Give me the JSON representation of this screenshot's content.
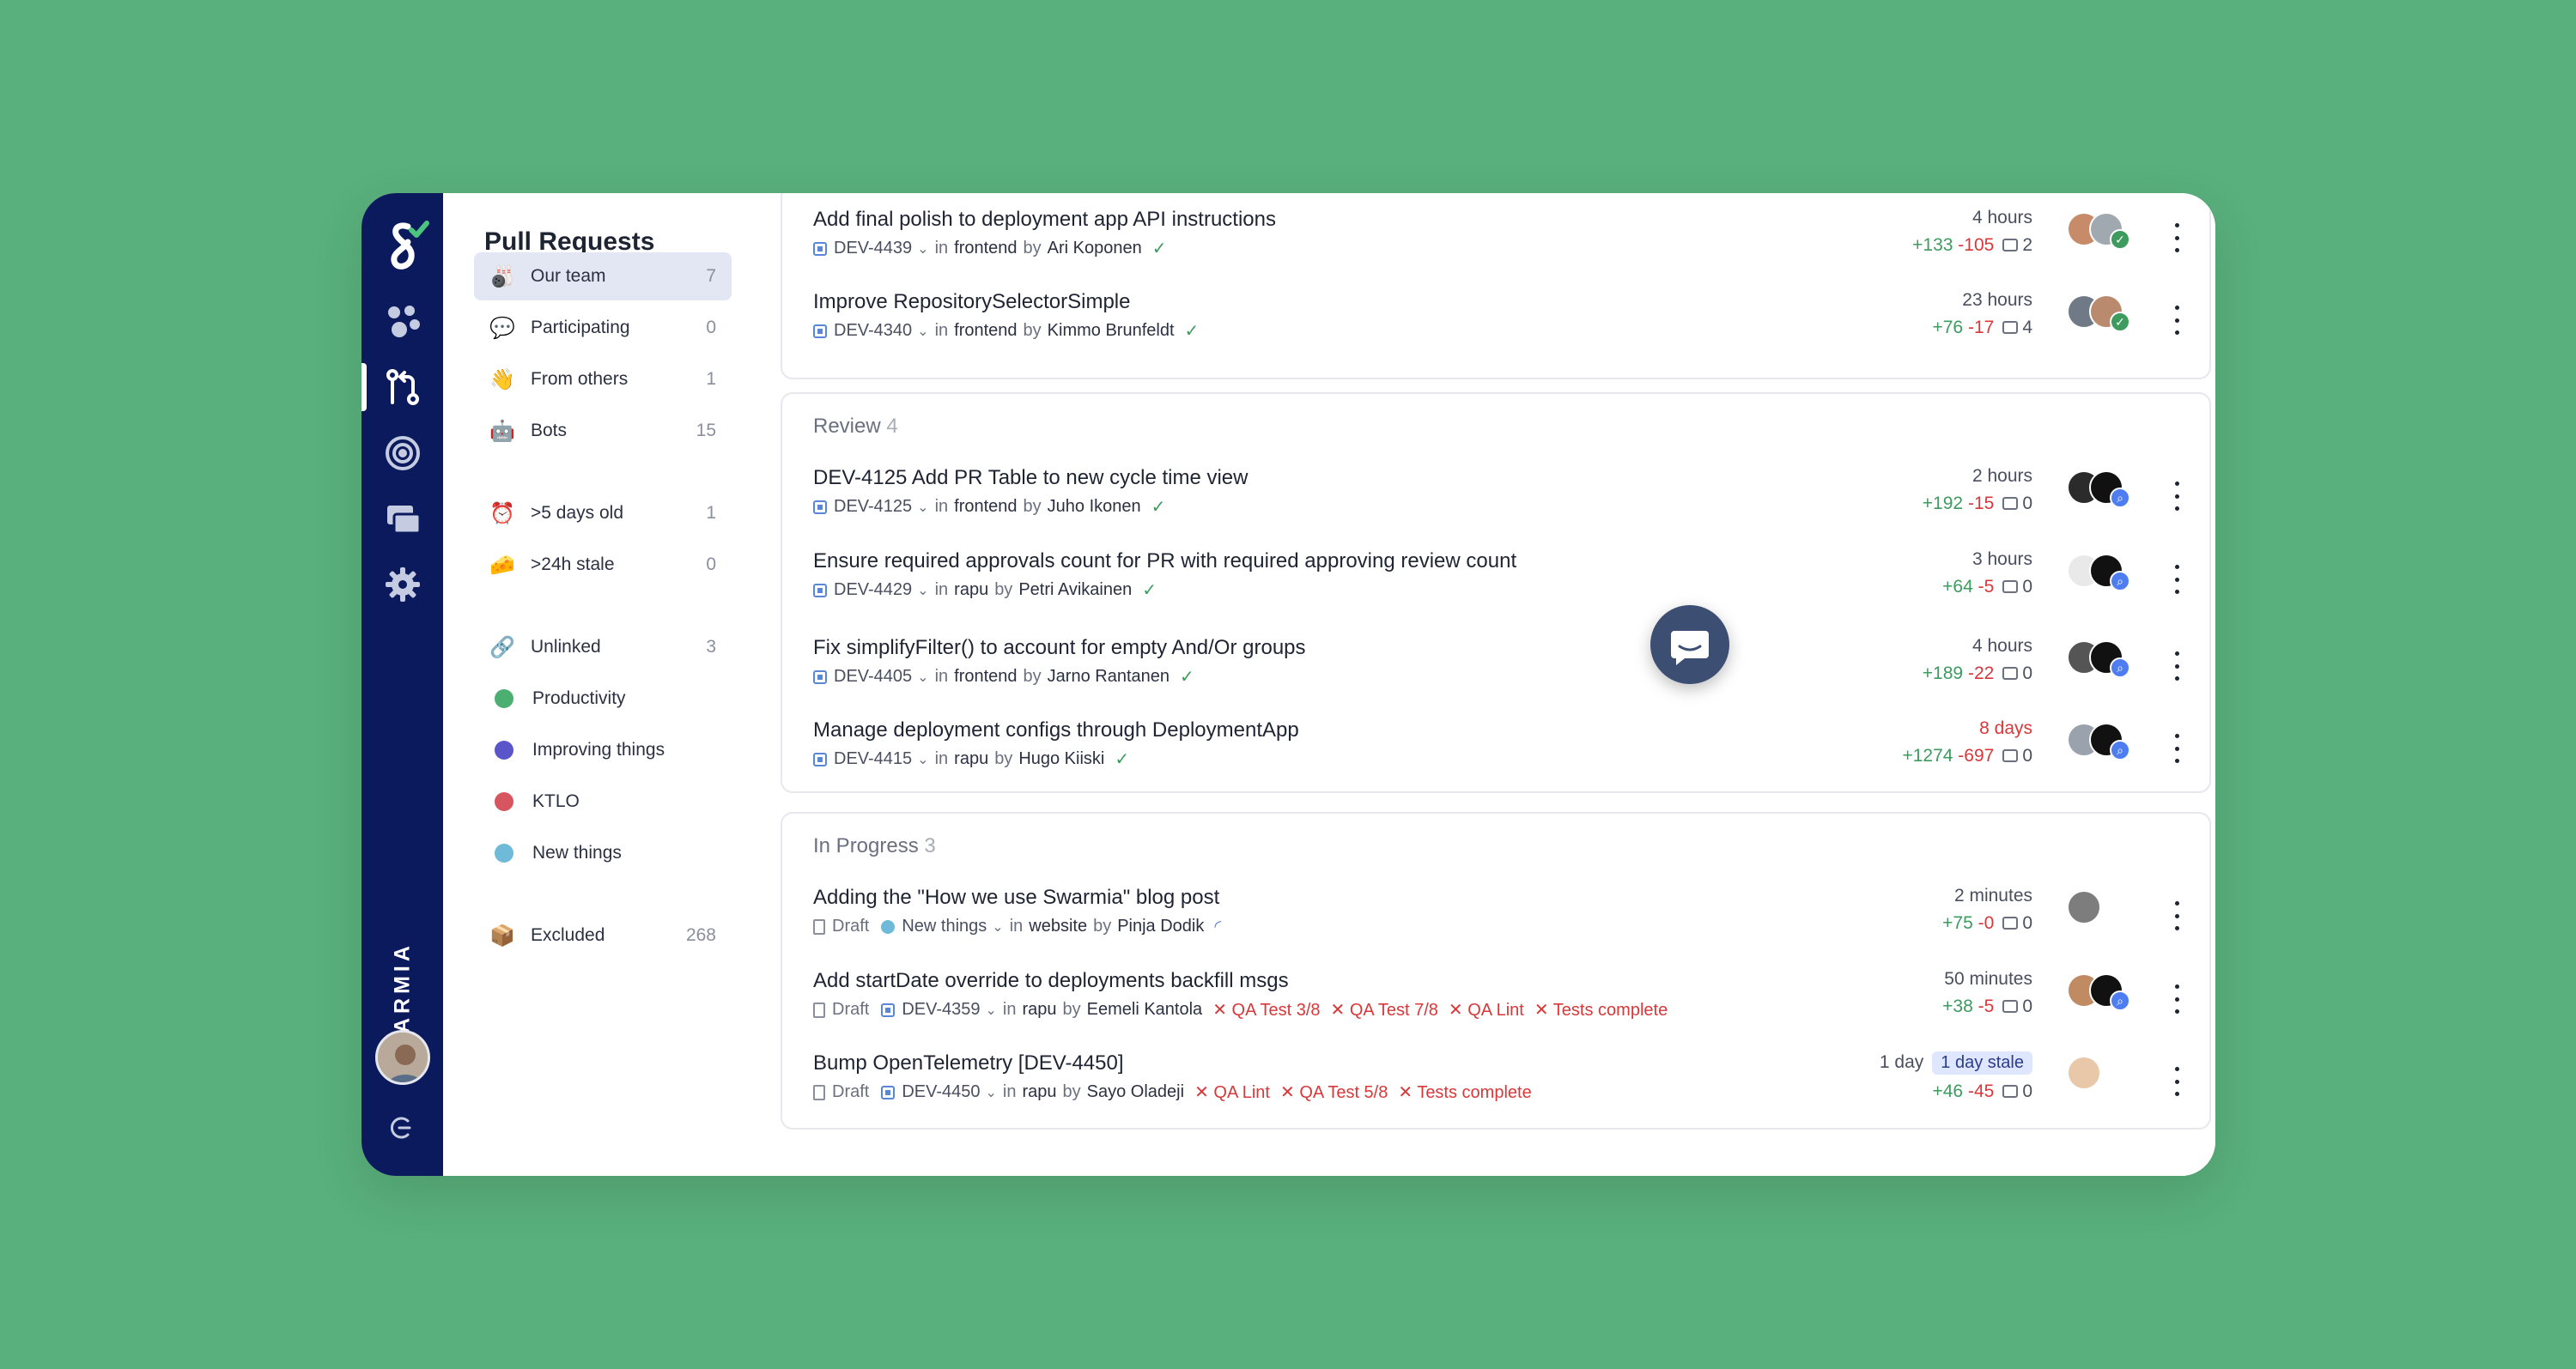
{
  "brand": "SWARMIA",
  "sidebar": {
    "title": "Pull Requests",
    "items": [
      {
        "emoji": "🎳",
        "label": "Our team",
        "count": "7"
      },
      {
        "emoji": "💬",
        "label": "Participating",
        "count": "0"
      },
      {
        "emoji": "👋",
        "label": "From others",
        "count": "1"
      },
      {
        "emoji": "🤖",
        "label": "Bots",
        "count": "15"
      },
      {
        "emoji": "⏰",
        "label": ">5 days old",
        "count": "1"
      },
      {
        "emoji": "🧀",
        "label": ">24h stale",
        "count": "0"
      },
      {
        "emoji": "🔗",
        "label": "Unlinked",
        "count": "3"
      },
      {
        "color": "#4caf72",
        "label": "Productivity",
        "count": ""
      },
      {
        "color": "#5a55c9",
        "label": "Improving things",
        "count": ""
      },
      {
        "color": "#d6555e",
        "label": "KTLO",
        "count": ""
      },
      {
        "color": "#6fbad9",
        "label": "New things",
        "count": ""
      },
      {
        "emoji": "📦",
        "label": "Excluded",
        "count": "268"
      }
    ]
  },
  "colors": {
    "accent": "#0b1a5c",
    "add": "#3d9b5e",
    "del": "#d8383a",
    "bg": "#59b07c"
  },
  "top_prs": [
    {
      "title": "Add final polish to deployment app API instructions",
      "key": "DEV-4439",
      "repo": "frontend",
      "author": "Ari Koponen",
      "time": "4 hours",
      "add": "+133",
      "del": "-105",
      "comments": "2"
    },
    {
      "title": "Improve RepositorySelectorSimple",
      "key": "DEV-4340",
      "repo": "frontend",
      "author": "Kimmo Brunfeldt",
      "time": "23 hours",
      "add": "+76",
      "del": "-17",
      "comments": "4"
    }
  ],
  "review": {
    "title": "Review",
    "count": "4",
    "prs": [
      {
        "title": "DEV-4125 Add PR Table to new cycle time view",
        "key": "DEV-4125",
        "repo": "frontend",
        "author": "Juho Ikonen",
        "time": "2 hours",
        "add": "+192",
        "del": "-15",
        "comments": "0"
      },
      {
        "title": "Ensure required approvals count for PR with required approving review count",
        "key": "DEV-4429",
        "repo": "rapu",
        "author": "Petri Avikainen",
        "time": "3 hours",
        "add": "+64",
        "del": "-5",
        "comments": "0"
      },
      {
        "title": "Fix simplifyFilter() to account for empty And/Or groups",
        "key": "DEV-4405",
        "repo": "frontend",
        "author": "Jarno Rantanen",
        "time": "4 hours",
        "add": "+189",
        "del": "-22",
        "comments": "0"
      },
      {
        "title": "Manage deployment configs through DeploymentApp",
        "key": "DEV-4415",
        "repo": "rapu",
        "author": "Hugo Kiiski",
        "time": "8 days",
        "add": "+1274",
        "del": "-697",
        "comments": "0"
      }
    ]
  },
  "in_progress": {
    "title": "In Progress",
    "count": "3",
    "prs": [
      {
        "title": "Adding the \"How we use Swarmia\" blog post",
        "draft": "Draft",
        "key": "New things",
        "repo": "website",
        "author": "Pinja Dodik",
        "time": "2 minutes",
        "add": "+75",
        "del": "-0",
        "comments": "0"
      },
      {
        "title": "Add startDate override to deployments backfill msgs",
        "draft": "Draft",
        "key": "DEV-4359",
        "repo": "rapu",
        "author": "Eemeli Kantola",
        "checks": [
          "QA Test 3/8",
          "QA Test 7/8",
          "QA Lint",
          "Tests complete"
        ],
        "time": "50 minutes",
        "add": "+38",
        "del": "-5",
        "comments": "0"
      },
      {
        "title": "Bump OpenTelemetry [DEV-4450]",
        "draft": "Draft",
        "key": "DEV-4450",
        "repo": "rapu",
        "author": "Sayo Oladeji",
        "checks": [
          "QA Lint",
          "QA Test 5/8",
          "Tests complete"
        ],
        "time": "1 day",
        "badge": "1 day stale",
        "add": "+46",
        "del": "-45",
        "comments": "0"
      }
    ]
  },
  "labels": {
    "in": "in",
    "by": "by"
  }
}
